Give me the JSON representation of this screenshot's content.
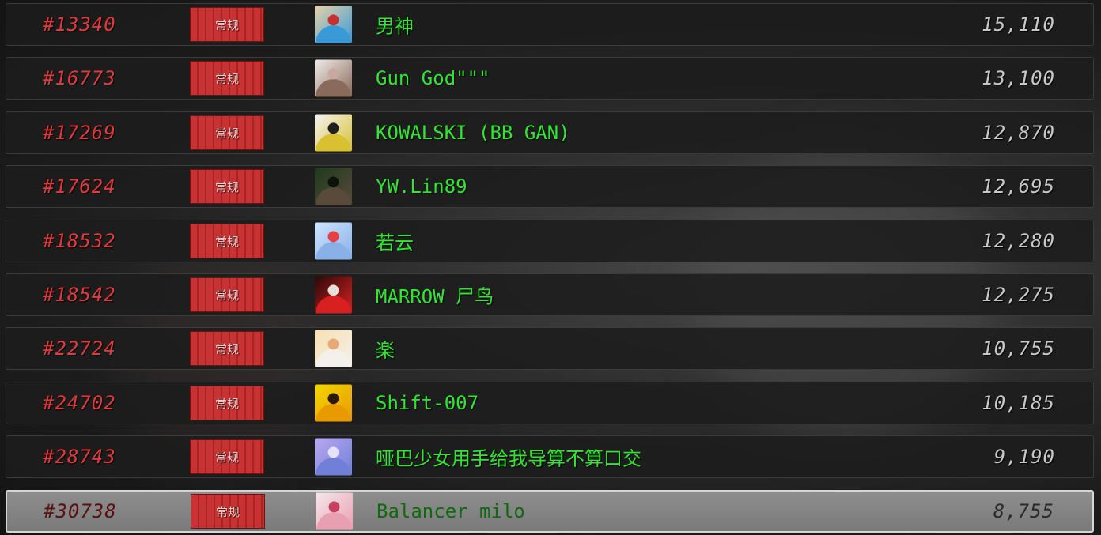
{
  "leaderboard": {
    "rows": [
      {
        "rank": "#13340",
        "tier": "常规",
        "name": "男神",
        "score": "15,110",
        "avatar_icon": "player-avatar-icon",
        "avatar_colors": [
          "#e8d2a8",
          "#3a9ad8",
          "#c83030"
        ],
        "highlight": false
      },
      {
        "rank": "#16773",
        "tier": "常规",
        "name": "Gun God\"\"\"",
        "score": "13,100",
        "avatar_icon": "player-avatar-icon",
        "avatar_colors": [
          "#f0ece8",
          "#8a6a5a",
          "#c8a8a0"
        ],
        "highlight": false
      },
      {
        "rank": "#17269",
        "tier": "常规",
        "name": "KOWALSKI (BB GAN)",
        "score": "12,870",
        "avatar_icon": "player-avatar-icon",
        "avatar_colors": [
          "#f4f4f4",
          "#d8c030",
          "#202020"
        ],
        "highlight": false
      },
      {
        "rank": "#17624",
        "tier": "常规",
        "name": "YW.Lin89",
        "score": "12,695",
        "avatar_icon": "player-avatar-icon",
        "avatar_colors": [
          "#1e3a1e",
          "#5a4a3a",
          "#0a140a"
        ],
        "highlight": false
      },
      {
        "rank": "#18532",
        "tier": "常规",
        "name": "若云",
        "score": "12,280",
        "avatar_icon": "player-avatar-icon",
        "avatar_colors": [
          "#cfe4ff",
          "#8ab0e8",
          "#e84040"
        ],
        "highlight": false
      },
      {
        "rank": "#18542",
        "tier": "常规",
        "name": "MARROW 尸鸟",
        "score": "12,275",
        "avatar_icon": "player-avatar-icon",
        "avatar_colors": [
          "#2a0a0a",
          "#d82020",
          "#e8e0d8"
        ],
        "highlight": false
      },
      {
        "rank": "#22724",
        "tier": "常规",
        "name": "楽",
        "score": "10,755",
        "avatar_icon": "player-avatar-icon",
        "avatar_colors": [
          "#f8e0b0",
          "#f4f0ec",
          "#e8a878"
        ],
        "highlight": false
      },
      {
        "rank": "#24702",
        "tier": "常规",
        "name": "Shift-007",
        "score": "10,185",
        "avatar_icon": "player-avatar-icon",
        "avatar_colors": [
          "#f4d600",
          "#e89a00",
          "#2a1a00"
        ],
        "highlight": false
      },
      {
        "rank": "#28743",
        "tier": "常规",
        "name": "哑巴少女用手给我导算不算口交",
        "score": "9,190",
        "avatar_icon": "player-avatar-icon",
        "avatar_colors": [
          "#b8a8f0",
          "#7080d8",
          "#e8e0ff"
        ],
        "highlight": false
      },
      {
        "rank": "#30738",
        "tier": "常规",
        "name": "Balancer milo",
        "score": "8,755",
        "avatar_icon": "player-avatar-icon",
        "avatar_colors": [
          "#f4e8ec",
          "#e8a0b0",
          "#c84060"
        ],
        "highlight": true
      }
    ]
  }
}
